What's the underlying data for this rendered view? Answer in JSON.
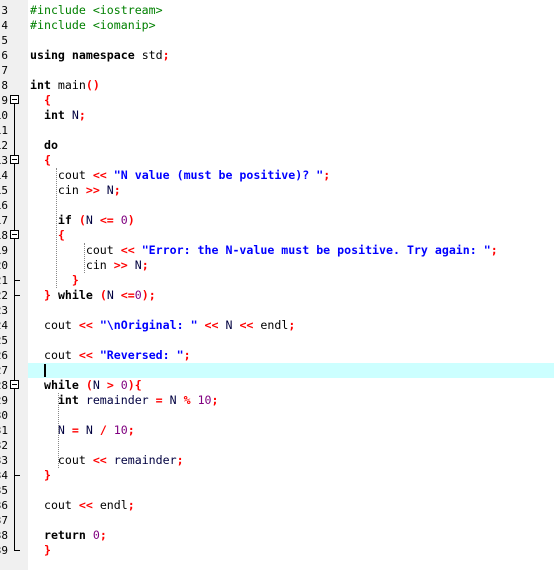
{
  "editor": {
    "first_line_number": 3,
    "current_line": 27,
    "highlight_color": "#ccffff",
    "fold_markers": [
      9,
      13,
      18,
      28
    ],
    "lines": [
      [
        [
          "pp",
          "#include <iostream>"
        ]
      ],
      [
        [
          "pp",
          "#include <iomanip>"
        ]
      ],
      [],
      [
        [
          "kw",
          "using namespace "
        ],
        [
          "tx",
          "std"
        ],
        [
          "op",
          ";"
        ]
      ],
      [],
      [
        [
          "kw",
          "int "
        ],
        [
          "tx",
          "main"
        ],
        [
          "op",
          "()"
        ]
      ],
      [
        [
          "tx",
          "  "
        ],
        [
          "op",
          "{"
        ]
      ],
      [
        [
          "tx",
          "  "
        ],
        [
          "kw",
          "int "
        ],
        [
          "id",
          "N"
        ],
        [
          "op",
          ";"
        ]
      ],
      [],
      [
        [
          "tx",
          "  "
        ],
        [
          "kw",
          "do"
        ]
      ],
      [
        [
          "tx",
          "  "
        ],
        [
          "op",
          "{"
        ]
      ],
      [
        [
          "tx",
          "    cout "
        ],
        [
          "op",
          "<< "
        ],
        [
          "str",
          "\"N value (must be positive)? \""
        ],
        [
          "op",
          ";"
        ]
      ],
      [
        [
          "tx",
          "    cin "
        ],
        [
          "op",
          ">> "
        ],
        [
          "id",
          "N"
        ],
        [
          "op",
          ";"
        ]
      ],
      [],
      [
        [
          "tx",
          "    "
        ],
        [
          "kw",
          "if "
        ],
        [
          "op",
          "("
        ],
        [
          "id",
          "N "
        ],
        [
          "op",
          "<= "
        ],
        [
          "num",
          "0"
        ],
        [
          "op",
          ")"
        ]
      ],
      [
        [
          "tx",
          "    "
        ],
        [
          "op",
          "{"
        ]
      ],
      [
        [
          "tx",
          "        cout "
        ],
        [
          "op",
          "<< "
        ],
        [
          "str",
          "\"Error: the N-value must be positive. Try again: \""
        ],
        [
          "op",
          ";"
        ]
      ],
      [
        [
          "tx",
          "        cin "
        ],
        [
          "op",
          ">> "
        ],
        [
          "id",
          "N"
        ],
        [
          "op",
          ";"
        ]
      ],
      [
        [
          "tx",
          "      "
        ],
        [
          "op",
          "}"
        ]
      ],
      [
        [
          "tx",
          "  "
        ],
        [
          "op",
          "} "
        ],
        [
          "kw",
          "while "
        ],
        [
          "op",
          "("
        ],
        [
          "id",
          "N "
        ],
        [
          "op",
          "<="
        ],
        [
          "num",
          "0"
        ],
        [
          "op",
          ");"
        ]
      ],
      [],
      [
        [
          "tx",
          "  cout "
        ],
        [
          "op",
          "<< "
        ],
        [
          "str",
          "\"\\nOriginal: \""
        ],
        [
          "op",
          " << "
        ],
        [
          "id",
          "N "
        ],
        [
          "op",
          "<< "
        ],
        [
          "tx",
          "endl"
        ],
        [
          "op",
          ";"
        ]
      ],
      [],
      [
        [
          "tx",
          "  cout "
        ],
        [
          "op",
          "<< "
        ],
        [
          "str",
          "\"Reversed: \""
        ],
        [
          "op",
          ";"
        ]
      ],
      [],
      [
        [
          "tx",
          "  "
        ],
        [
          "kw",
          "while "
        ],
        [
          "op",
          "("
        ],
        [
          "id",
          "N "
        ],
        [
          "op",
          "> "
        ],
        [
          "num",
          "0"
        ],
        [
          "op",
          "){"
        ]
      ],
      [
        [
          "tx",
          "    "
        ],
        [
          "kw",
          "int "
        ],
        [
          "id",
          "remainder "
        ],
        [
          "op",
          "= "
        ],
        [
          "id",
          "N "
        ],
        [
          "op",
          "% "
        ],
        [
          "num",
          "10"
        ],
        [
          "op",
          ";"
        ]
      ],
      [],
      [
        [
          "tx",
          "    "
        ],
        [
          "id",
          "N "
        ],
        [
          "op",
          "= "
        ],
        [
          "id",
          "N "
        ],
        [
          "op",
          "/ "
        ],
        [
          "num",
          "10"
        ],
        [
          "op",
          ";"
        ]
      ],
      [],
      [
        [
          "tx",
          "    cout "
        ],
        [
          "op",
          "<< "
        ],
        [
          "id",
          "remainder"
        ],
        [
          "op",
          ";"
        ]
      ],
      [
        [
          "tx",
          "  "
        ],
        [
          "op",
          "}"
        ]
      ],
      [],
      [
        [
          "tx",
          "  cout "
        ],
        [
          "op",
          "<< "
        ],
        [
          "tx",
          "endl"
        ],
        [
          "op",
          ";"
        ]
      ],
      [],
      [
        [
          "tx",
          "  "
        ],
        [
          "kw",
          "return "
        ],
        [
          "num",
          "0"
        ],
        [
          "op",
          ";"
        ]
      ],
      [
        [
          "tx",
          "  "
        ],
        [
          "op",
          "}"
        ]
      ]
    ]
  }
}
